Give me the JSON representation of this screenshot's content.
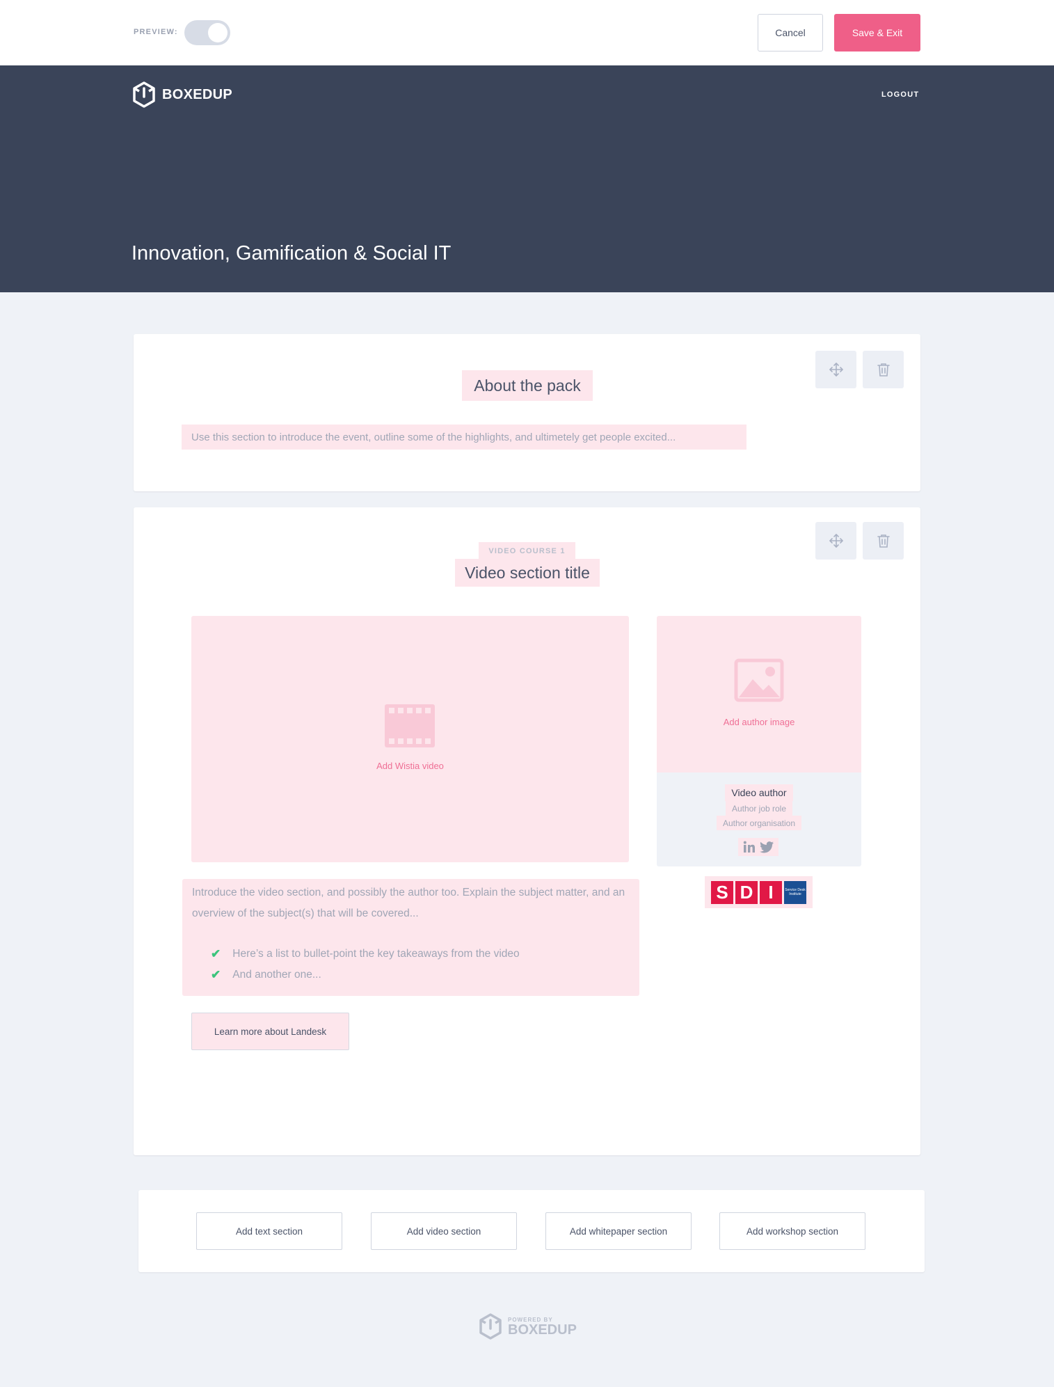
{
  "toolbar": {
    "preview_label": "PREVIEW:",
    "cancel_label": "Cancel",
    "save_label": "Save & Exit",
    "accent_color": "#ef5f88"
  },
  "header": {
    "brand": "BOXEDUP",
    "logout_label": "LOGOUT",
    "title": "Innovation, Gamification & Social IT",
    "background_color": "#3a4459"
  },
  "sections": [
    {
      "type": "text",
      "title": "About the pack",
      "body": "Use this section to introduce the event, outline some of the highlights, and ultimetely get people excited..."
    },
    {
      "type": "video",
      "label": "VIDEO COURSE 1",
      "title": "Video section title",
      "video_placeholder": "Add Wistia video",
      "author": {
        "image_placeholder": "Add author image",
        "name": "Video author",
        "role": "Author job role",
        "organisation": "Author organisation"
      },
      "intro": "Introduce the video section, and possibly the author too. Explain the subject matter, and an overview of the subject(s) that will be covered...",
      "bullets": [
        "Here’s a list to bullet-point the key takeaways from the video",
        "And another one..."
      ],
      "cta_label": "Learn more about Landesk",
      "sponsor_logo": {
        "letters": [
          "S",
          "D",
          "I"
        ],
        "tagline": "Service Desk Institute"
      }
    }
  ],
  "add_section_buttons": [
    "Add text section",
    "Add video section",
    "Add whitepaper section",
    "Add workshop section"
  ],
  "footer": {
    "powered_by": "POWERED BY",
    "brand": "BOXEDUP"
  }
}
